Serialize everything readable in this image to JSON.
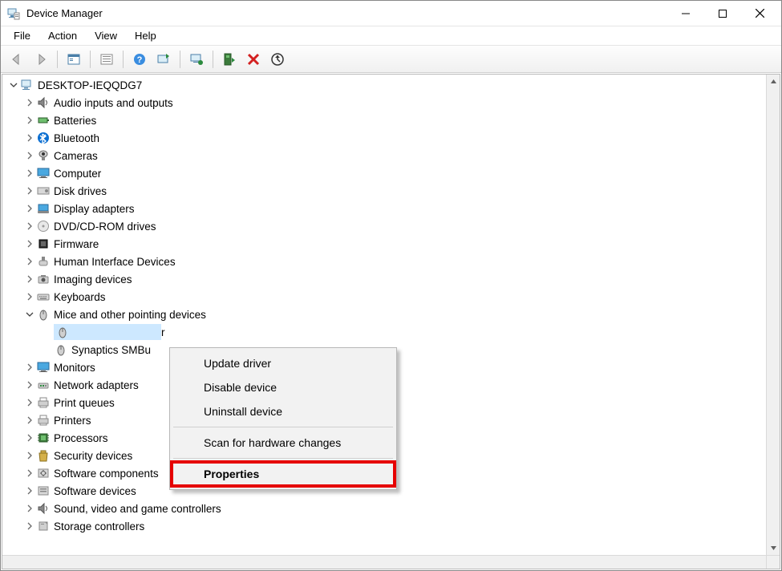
{
  "window": {
    "title": "Device Manager"
  },
  "menubar": {
    "file": "File",
    "action": "Action",
    "view": "View",
    "help": "Help"
  },
  "tree": {
    "root": "DESKTOP-IEQQDG7",
    "nodes": [
      {
        "label": "Audio inputs and outputs"
      },
      {
        "label": "Batteries"
      },
      {
        "label": "Bluetooth"
      },
      {
        "label": "Cameras"
      },
      {
        "label": "Computer"
      },
      {
        "label": "Disk drives"
      },
      {
        "label": "Display adapters"
      },
      {
        "label": "DVD/CD-ROM drives"
      },
      {
        "label": "Firmware"
      },
      {
        "label": "Human Interface Devices"
      },
      {
        "label": "Imaging devices"
      },
      {
        "label": "Keyboards"
      },
      {
        "label": "Mice and other pointing devices"
      },
      {
        "label": "Monitors"
      },
      {
        "label": "Network adapters"
      },
      {
        "label": "Print queues"
      },
      {
        "label": "Printers"
      },
      {
        "label": "Processors"
      },
      {
        "label": "Security devices"
      },
      {
        "label": "Software components"
      },
      {
        "label": "Software devices"
      },
      {
        "label": "Sound, video and game controllers"
      },
      {
        "label": "Storage controllers"
      }
    ],
    "selected_partial": "r",
    "mice_child": "Synaptics SMBu"
  },
  "context_menu": {
    "update": "Update driver",
    "disable": "Disable device",
    "uninstall": "Uninstall device",
    "scan": "Scan for hardware changes",
    "properties": "Properties"
  }
}
